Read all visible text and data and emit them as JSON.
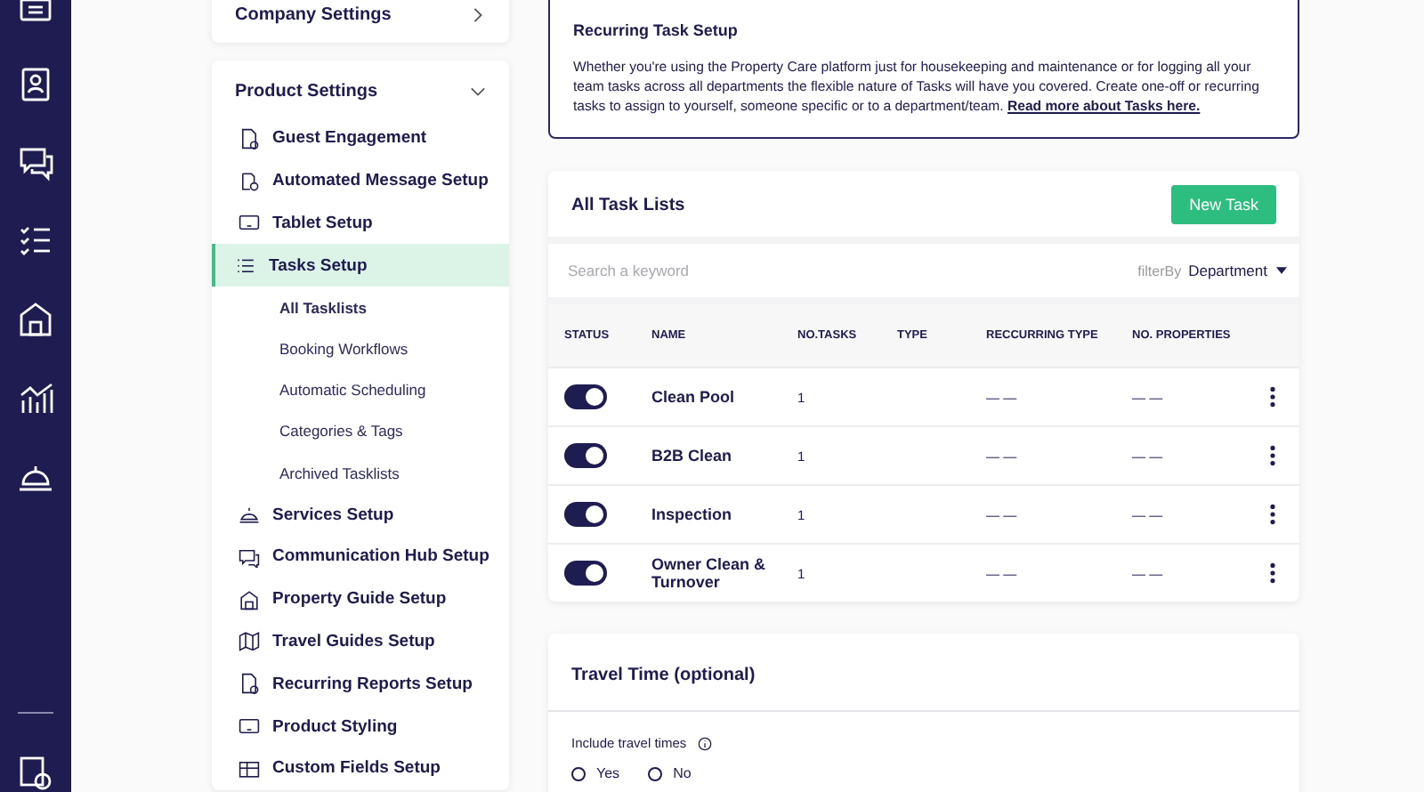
{
  "settings_nav": {
    "company_settings": {
      "title": "Company Settings",
      "expanded": false
    },
    "product_settings": {
      "title": "Product Settings",
      "expanded": true,
      "items": [
        {
          "label": "Guest Engagement",
          "selected": false
        },
        {
          "label": "Automated Message Setup",
          "selected": false
        },
        {
          "label": "Tablet Setup",
          "selected": false
        },
        {
          "label": "Tasks Setup",
          "selected": true,
          "children": [
            {
              "label": "All Tasklists",
              "selected": true
            },
            {
              "label": "Booking Workflows",
              "selected": false
            },
            {
              "label": "Automatic Scheduling",
              "selected": false
            },
            {
              "label": "Categories & Tags",
              "selected": false
            },
            {
              "label": "Archived Tasklists",
              "selected": false
            }
          ]
        },
        {
          "label": "Services Setup",
          "selected": false
        },
        {
          "label": "Communication Hub Setup",
          "selected": false
        },
        {
          "label": "Property Guide Setup",
          "selected": false
        },
        {
          "label": "Travel Guides Setup",
          "selected": false
        },
        {
          "label": "Recurring Reports Setup",
          "selected": false
        },
        {
          "label": "Product Styling",
          "selected": false
        },
        {
          "label": "Custom Fields Setup",
          "selected": false
        }
      ]
    }
  },
  "info_box": {
    "title": "Recurring Task Setup",
    "text": "Whether you're using the Property Care platform just for housekeeping and maintenance or for logging all your team tasks across all departments the flexible nature of Tasks will have you covered. Create one-off or recurring tasks to assign to yourself, someone specific or to a department/team.",
    "link": "Read more about Tasks here."
  },
  "task_lists": {
    "title": "All Task Lists",
    "button": "New Task",
    "search": {
      "placeholder": "Search a keyword"
    },
    "filter": {
      "label": "filterBy",
      "value": "Department"
    },
    "columns": [
      "STATUS",
      "NAME",
      "NO.TASKS",
      "TYPE",
      "RECCURRING TYPE",
      "NO. PROPERTIES"
    ],
    "rows": [
      {
        "on": true,
        "name": "Clean Pool",
        "tasks": "1",
        "type": "",
        "recurring_type": "— —",
        "properties": "— —"
      },
      {
        "on": true,
        "name": "B2B Clean",
        "tasks": "1",
        "type": "",
        "recurring_type": "— —",
        "properties": "— —"
      },
      {
        "on": true,
        "name": "Inspection",
        "tasks": "1",
        "type": "",
        "recurring_type": "— —",
        "properties": "— —"
      },
      {
        "on": true,
        "name": "Owner Clean & Turnover",
        "tasks": "1",
        "type": "",
        "recurring_type": "— —",
        "properties": "— —"
      }
    ]
  },
  "travel_time": {
    "title": "Travel Time (optional)",
    "question": "Include travel times",
    "options": [
      {
        "label": "Yes",
        "selected": false
      },
      {
        "label": "No",
        "selected": false
      }
    ]
  }
}
